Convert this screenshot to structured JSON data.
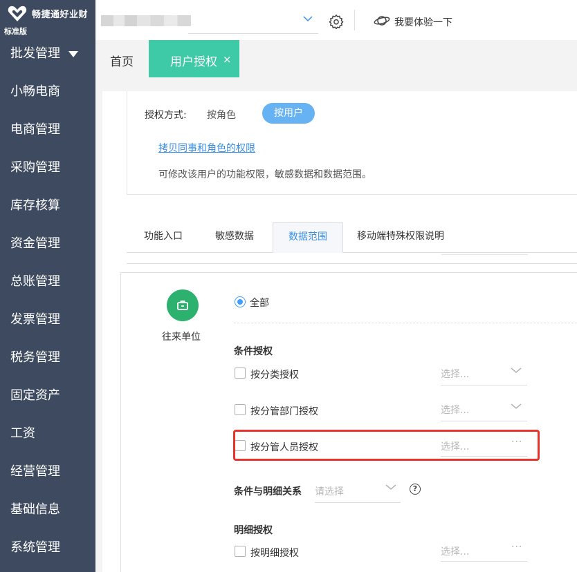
{
  "app": {
    "brand": "畅捷通好业财",
    "edition": "标准版",
    "try_label": "我要体验一下"
  },
  "sidebar": {
    "items": [
      {
        "label": "批发管理",
        "expanded": true
      },
      {
        "label": "小畅电商"
      },
      {
        "label": "电商管理"
      },
      {
        "label": "采购管理"
      },
      {
        "label": "库存核算"
      },
      {
        "label": "资金管理"
      },
      {
        "label": "总账管理"
      },
      {
        "label": "发票管理"
      },
      {
        "label": "税务管理"
      },
      {
        "label": "固定资产"
      },
      {
        "label": "工资"
      },
      {
        "label": "经营管理"
      },
      {
        "label": "基础信息"
      },
      {
        "label": "系统管理"
      }
    ]
  },
  "tabs": {
    "home": "首页",
    "active": "用户授权",
    "close": "×"
  },
  "auth": {
    "mode_label": "授权方式:",
    "by_role": "按角色",
    "by_user": "按用户",
    "copy_link": "拷贝同事和角色的权限",
    "description": "可修改该用户的功能权限，敏感数据和数据范围。"
  },
  "sub_tabs": [
    "功能入口",
    "敏感数据",
    "数据范围",
    "移动端特殊权限说明"
  ],
  "active_sub_tab": "数据范围",
  "scope": {
    "entity": "往来单位",
    "all_option": "全部",
    "condition_title": "条件授权",
    "conditions": [
      {
        "label": "按分类授权",
        "placeholder": "选择...",
        "control": "dropdown"
      },
      {
        "label": "按分管部门授权",
        "placeholder": "选择...",
        "control": "dropdown"
      },
      {
        "label": "按分管人员授权",
        "placeholder": "选择...",
        "control": "ellipsis"
      }
    ],
    "relation_label": "条件与明细关系",
    "relation_placeholder": "请选择",
    "help_icon": "?",
    "detail_title": "明细授权",
    "detail_option": {
      "label": "按明细授权",
      "placeholder": "选择...",
      "control": "ellipsis"
    },
    "ellipsis": "···"
  },
  "colors": {
    "sidebar_bg": "#3d4a5f",
    "active_tab": "#3ec9a7",
    "accent_blue": "#409eff",
    "entity_green": "#2db16e",
    "highlight_red": "#e8322b"
  }
}
